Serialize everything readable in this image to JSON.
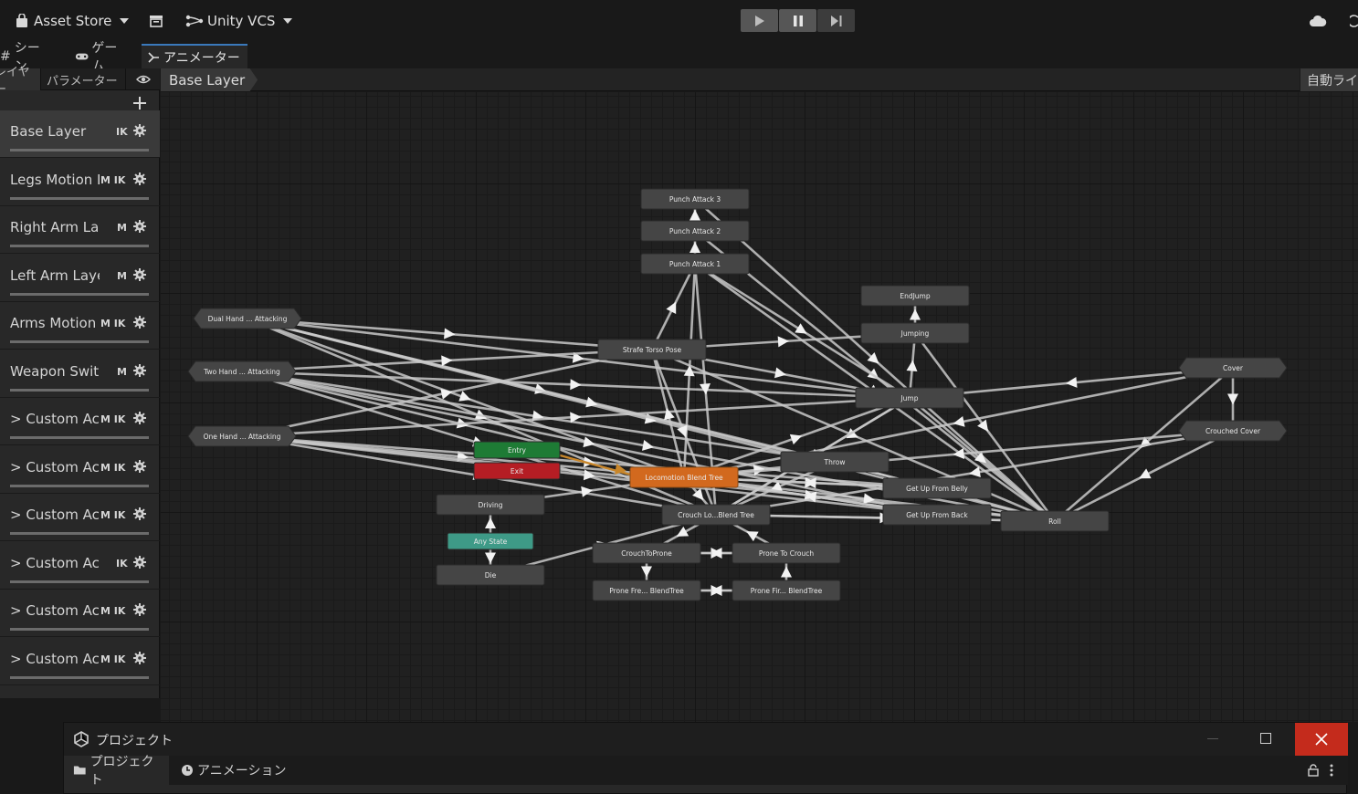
{
  "toolbar": {
    "asset_store": "Asset Store",
    "vcs": "Unity VCS"
  },
  "tabs": [
    {
      "label": "シーン"
    },
    {
      "label": "ゲーム"
    },
    {
      "label": "アニメーター"
    }
  ],
  "left_panel": {
    "tab_layers": "レイヤー",
    "tab_params": "パラメーター",
    "layers": [
      {
        "name": "Base Layer",
        "badges": "IK"
      },
      {
        "name": "Legs Motion Layer",
        "badges": "M IK"
      },
      {
        "name": "Right Arm Layer",
        "badges": "M"
      },
      {
        "name": "Left Arm Layer",
        "badges": "M"
      },
      {
        "name": "Arms Motion",
        "badges": "M IK"
      },
      {
        "name": "Weapon Switch",
        "badges": "M"
      },
      {
        "name": "> Custom Action",
        "badges": "M IK"
      },
      {
        "name": "> Custom Action",
        "badges": "M IK"
      },
      {
        "name": "> Custom Action",
        "badges": "M IK"
      },
      {
        "name": "> Custom Action",
        "badges": "IK"
      },
      {
        "name": "> Custom Action",
        "badges": "M IK"
      },
      {
        "name": "> Custom Action",
        "badges": "M IK"
      }
    ]
  },
  "graph": {
    "breadcrumb": "Base Layer",
    "auto_live": "自動ライブ",
    "states": [
      {
        "id": "pa3",
        "label": "Punch Attack 3",
        "kind": "normal"
      },
      {
        "id": "pa2",
        "label": "Punch Attack 2",
        "kind": "normal"
      },
      {
        "id": "pa1",
        "label": "Punch Attack 1",
        "kind": "normal"
      },
      {
        "id": "endjump",
        "label": "EndJump",
        "kind": "normal"
      },
      {
        "id": "jumping",
        "label": "Jumping",
        "kind": "normal"
      },
      {
        "id": "dual",
        "label": "Dual Hand ... Attacking",
        "kind": "sub"
      },
      {
        "id": "two",
        "label": "Two Hand ... Attacking",
        "kind": "sub"
      },
      {
        "id": "one",
        "label": "One Hand ... Attacking",
        "kind": "sub"
      },
      {
        "id": "strafe",
        "label": "Strafe Torso Pose",
        "kind": "normal"
      },
      {
        "id": "jump",
        "label": "Jump",
        "kind": "normal"
      },
      {
        "id": "cover",
        "label": "Cover",
        "kind": "sub"
      },
      {
        "id": "ccover",
        "label": "Crouched Cover",
        "kind": "sub"
      },
      {
        "id": "entry",
        "label": "Entry",
        "kind": "entry"
      },
      {
        "id": "exit",
        "label": "Exit",
        "kind": "exit"
      },
      {
        "id": "loco",
        "label": "Locomotion Blend Tree",
        "kind": "default"
      },
      {
        "id": "throw",
        "label": "Throw",
        "kind": "normal"
      },
      {
        "id": "belly",
        "label": "Get Up From Belly",
        "kind": "normal"
      },
      {
        "id": "back",
        "label": "Get Up From Back",
        "kind": "normal"
      },
      {
        "id": "roll",
        "label": "Roll",
        "kind": "normal"
      },
      {
        "id": "driving",
        "label": "Driving",
        "kind": "normal"
      },
      {
        "id": "crouchbt",
        "label": "Crouch Lo...Blend Tree",
        "kind": "normal"
      },
      {
        "id": "anystate",
        "label": "Any State",
        "kind": "any"
      },
      {
        "id": "die",
        "label": "Die",
        "kind": "normal"
      },
      {
        "id": "c2p",
        "label": "CrouchToProne",
        "kind": "normal"
      },
      {
        "id": "p2c",
        "label": "Prone To Crouch",
        "kind": "normal"
      },
      {
        "id": "pfre",
        "label": "Prone Fre... BlendTree",
        "kind": "normal"
      },
      {
        "id": "pfir",
        "label": "Prone Fir... BlendTree",
        "kind": "normal"
      }
    ]
  },
  "project_window": {
    "title": "プロジェクト",
    "tab_project": "プロジェクト",
    "tab_animation": "アニメーション"
  },
  "colors": {
    "accent": "#3a79bb",
    "state": "#454545",
    "entry": "#1e7b35",
    "exit": "#b51d24",
    "default_state": "#d2691e",
    "any_state": "#3e9a87",
    "close": "#c42b1c"
  }
}
